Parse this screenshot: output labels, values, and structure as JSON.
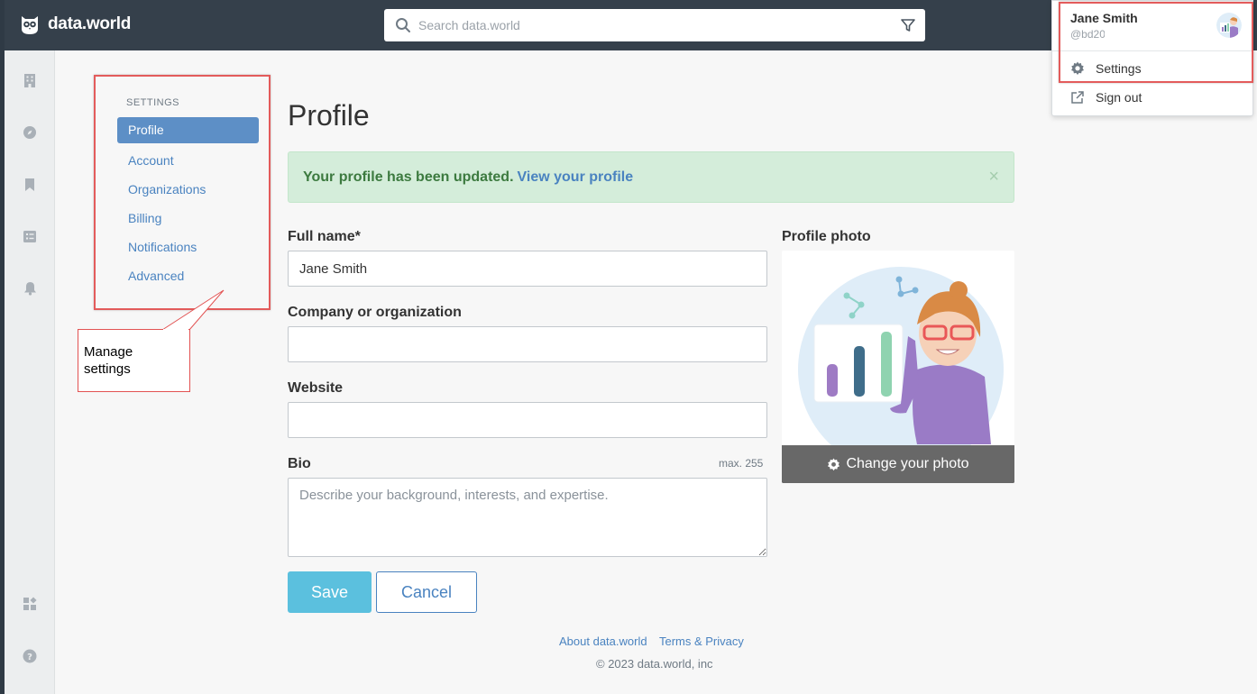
{
  "app": {
    "logo_text": "data.world"
  },
  "search": {
    "placeholder": "Search data.world"
  },
  "rail": {
    "icons": [
      "building-icon",
      "compass-icon",
      "bookmark-icon",
      "checklist-icon",
      "bell-icon",
      "apps-icon",
      "help-icon"
    ]
  },
  "settings_nav": {
    "title": "SETTINGS",
    "items": [
      {
        "label": "Profile",
        "active": true
      },
      {
        "label": "Account"
      },
      {
        "label": "Organizations"
      },
      {
        "label": "Billing"
      },
      {
        "label": "Notifications"
      },
      {
        "label": "Advanced"
      }
    ]
  },
  "callout": {
    "line1": "Manage",
    "line2": "settings"
  },
  "main": {
    "title": "Profile",
    "alert": {
      "message": "Your profile has been updated.",
      "link": "View your profile",
      "close": "×"
    },
    "full_name": {
      "label": "Full name*",
      "value": "Jane Smith"
    },
    "company": {
      "label": "Company or organization",
      "value": ""
    },
    "website": {
      "label": "Website",
      "value": ""
    },
    "bio": {
      "label": "Bio",
      "max_note": "max. 255",
      "placeholder": "Describe your background, interests, and expertise."
    },
    "save_label": "Save",
    "cancel_label": "Cancel",
    "photo": {
      "label": "Profile photo",
      "change_label": "Change your photo"
    }
  },
  "footer": {
    "about": "About data.world",
    "terms": "Terms & Privacy",
    "copyright": "© 2023 data.world, inc"
  },
  "user_menu": {
    "name": "Jane Smith",
    "handle": "@bd20",
    "settings_label": "Settings",
    "signout_label": "Sign out"
  },
  "colors": {
    "topbar": "#35404b",
    "accent": "#4a83c0",
    "active_nav": "#5d8fc6",
    "save": "#5bc0de",
    "success_bg": "#d4edda",
    "annotation": "#e35b5b"
  }
}
